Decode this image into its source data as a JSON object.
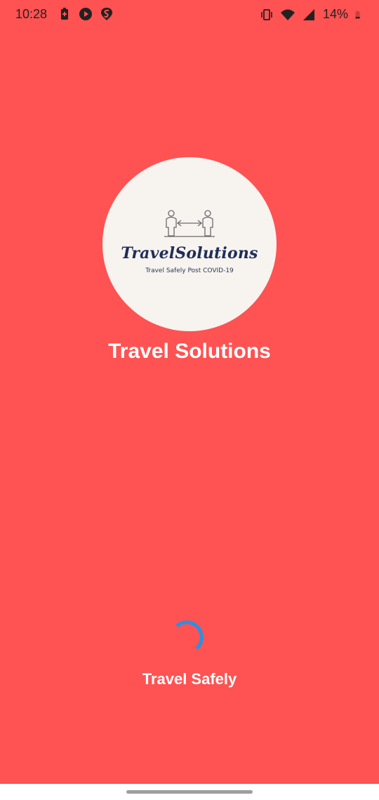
{
  "status_bar": {
    "time": "10:28",
    "battery_percent": "14%",
    "left_icons": [
      "battery-saver-icon",
      "play-icon",
      "swiggy-icon"
    ],
    "right_icons": [
      "vibrate-icon",
      "wifi-icon",
      "signal-icon",
      "battery-low-icon"
    ]
  },
  "logo": {
    "wordmark": "TravelSolutions",
    "tagline": "Travel Safely Post COVID-19",
    "illustration": "social-distancing-icon"
  },
  "app_title": "Travel Solutions",
  "loading": {
    "label": "Travel Safely",
    "spinner_icon": "loading-spinner-icon",
    "spinner_color": "#2F8FE0"
  },
  "colors": {
    "background": "#FF5252",
    "logo_circle": "#F7F3EF",
    "wordmark": "#1F2E57"
  }
}
